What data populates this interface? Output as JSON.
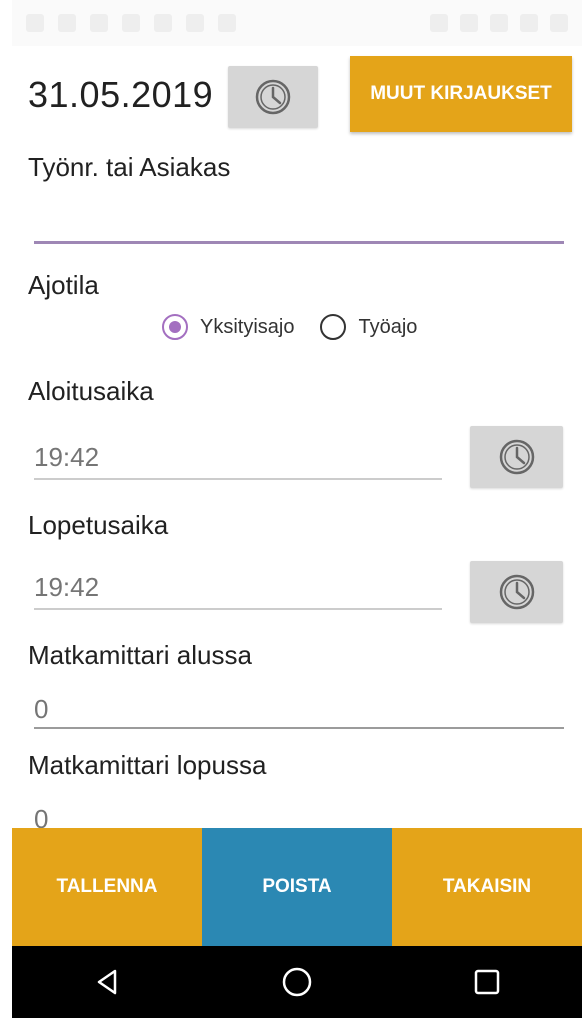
{
  "header": {
    "date": "31.05.2019",
    "other_entries_button": "MUUT KIRJAUKSET"
  },
  "form": {
    "job_label": "Työnr. tai Asiakas",
    "job_value": "",
    "mode_label": "Ajotila",
    "mode_options": [
      {
        "label": "Yksityisajo",
        "selected": true
      },
      {
        "label": "Työajo",
        "selected": false
      }
    ],
    "start_label": "Aloitusaika",
    "start_value": "19:42",
    "end_label": "Lopetusaika",
    "end_value": "19:42",
    "odometer_start_label": "Matkamittari alussa",
    "odometer_start_value": "0",
    "odometer_end_label": "Matkamittari lopussa",
    "odometer_end_value": "0"
  },
  "actions": {
    "save": "TALLENNA",
    "delete": "POISTA",
    "back": "TAKAISIN"
  },
  "colors": {
    "accent_orange": "#e4a419",
    "accent_blue": "#2b88b3",
    "radio_purple": "#a36fc0"
  },
  "icons": {
    "clock": "clock-icon",
    "nav_back": "nav-back-icon",
    "nav_home": "nav-home-icon",
    "nav_recents": "nav-recents-icon"
  }
}
